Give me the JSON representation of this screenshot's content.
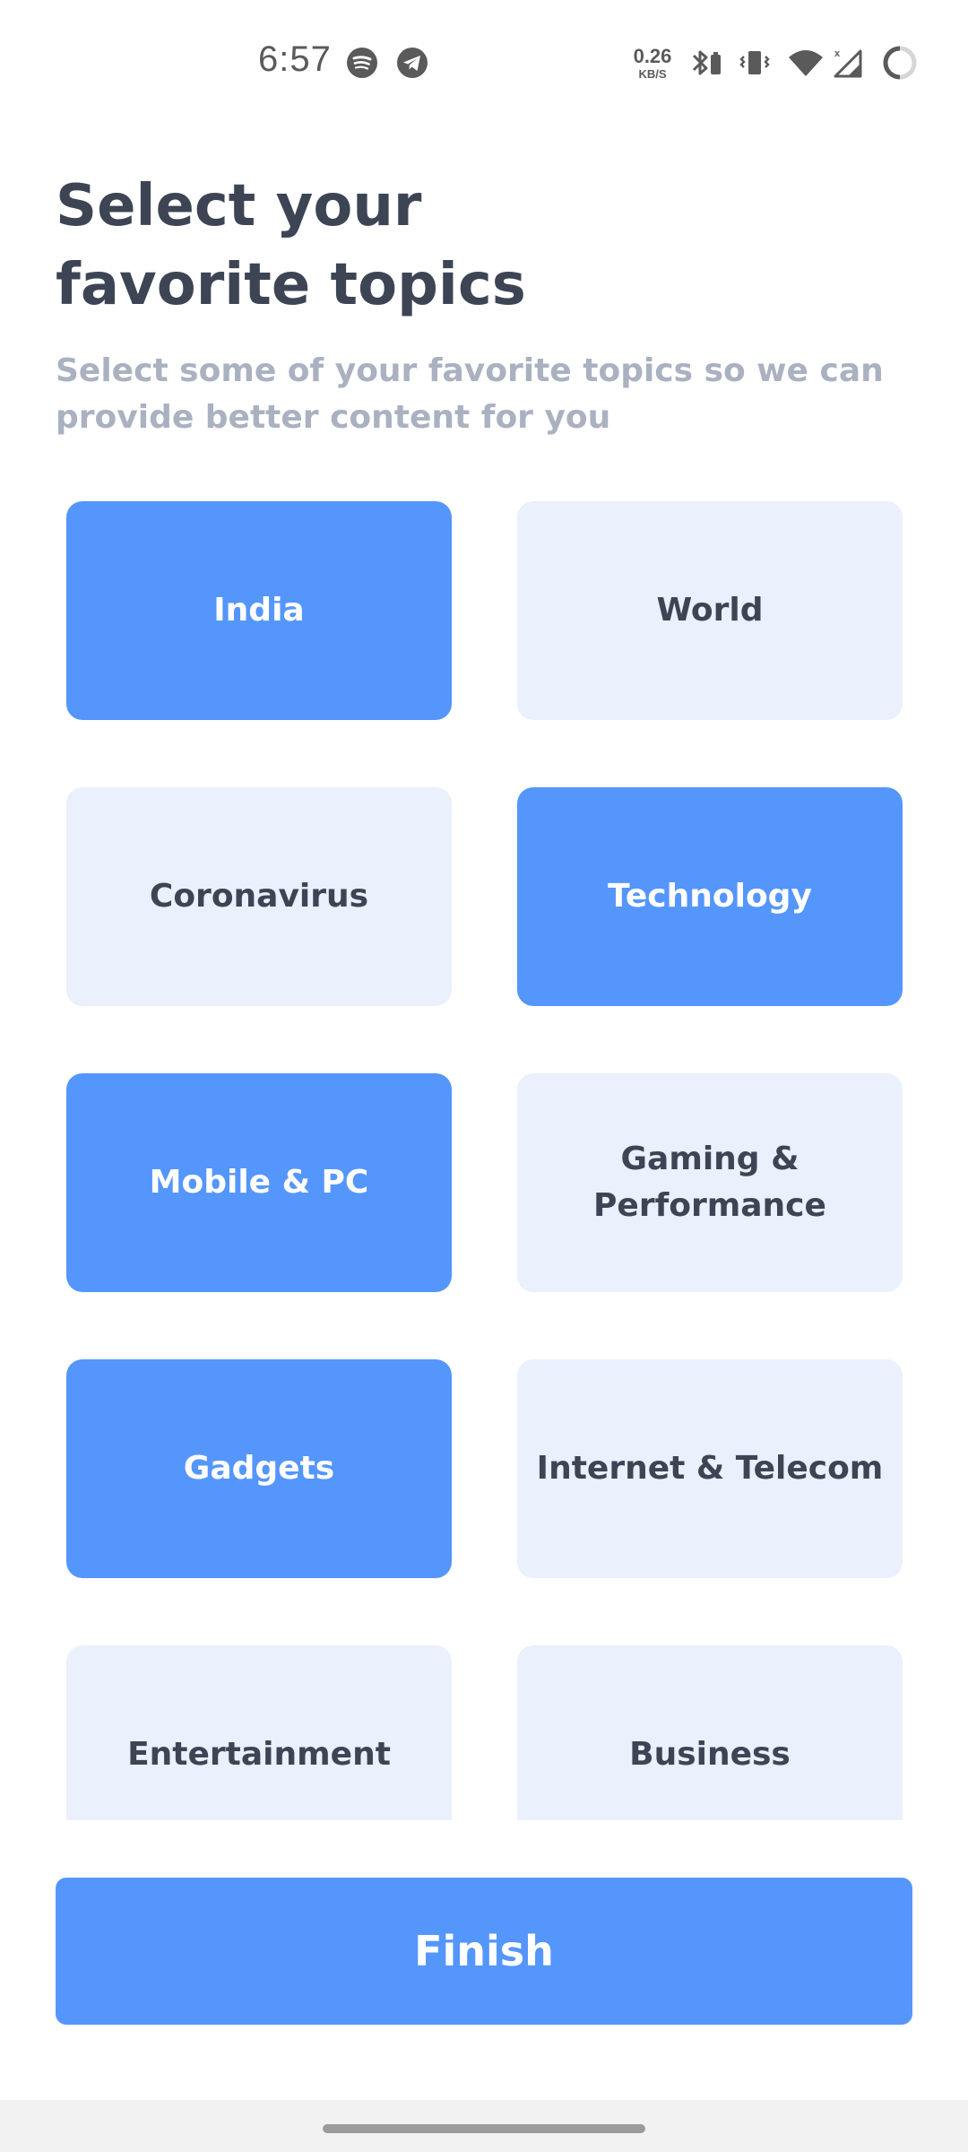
{
  "status_bar": {
    "time": "6:57",
    "net_speed_value": "0.26",
    "net_speed_unit": "KB/S",
    "icons": [
      "spotify-icon",
      "telegram-icon",
      "bluetooth-icon",
      "vibrate-icon",
      "wifi-icon",
      "cell-signal-icon",
      "battery-icon"
    ]
  },
  "header": {
    "title": "Select your\nfavorite topics",
    "subtitle": "Select some of your favorite topics so we can provide better content for you"
  },
  "topics": [
    {
      "label": "India",
      "selected": true
    },
    {
      "label": "World",
      "selected": false
    },
    {
      "label": "Coronavirus",
      "selected": false
    },
    {
      "label": "Technology",
      "selected": true
    },
    {
      "label": "Mobile & PC",
      "selected": true
    },
    {
      "label": "Gaming & Performance",
      "selected": false
    },
    {
      "label": "Gadgets",
      "selected": true
    },
    {
      "label": "Internet & Telecom",
      "selected": false
    },
    {
      "label": "Entertainment",
      "selected": false
    },
    {
      "label": "Business",
      "selected": false
    }
  ],
  "finish_button": {
    "label": "Finish"
  },
  "colors": {
    "accent": "#5596fd",
    "card_unselected": "#eaf0fc",
    "title_text": "#3d4555",
    "subtitle_text": "#aab1c0"
  }
}
